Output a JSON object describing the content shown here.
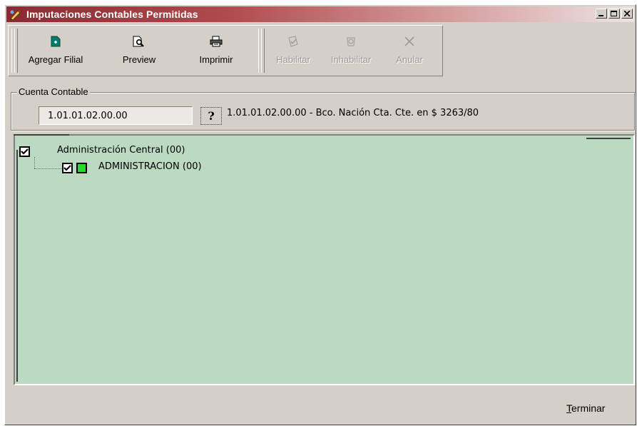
{
  "window": {
    "title": "Imputaciones Contables Permitidas",
    "controls": [
      "minimize",
      "maximize",
      "close"
    ]
  },
  "toolbar": {
    "buttons": [
      {
        "label": "Agregar Filial",
        "icon": "add-document-icon",
        "enabled": true
      },
      {
        "label": "Preview",
        "icon": "print-preview-icon",
        "enabled": true
      },
      {
        "label": "Imprimir",
        "icon": "printer-icon",
        "enabled": true
      },
      {
        "label": "Habilitar",
        "icon": "enable-check-icon",
        "enabled": false
      },
      {
        "label": "Inhabilitar",
        "icon": "disable-icon",
        "enabled": false
      },
      {
        "label": "Anular",
        "icon": "cancel-x-icon",
        "enabled": false
      }
    ]
  },
  "cuenta": {
    "legend": "Cuenta Contable",
    "value": "1.01.01.02.00.00",
    "help_glyph": "?",
    "description": "1.01.01.02.00.00  -  Bco. Nación Cta. Cte. en $ 3263/80"
  },
  "tree": {
    "root": {
      "label": "Administración Central (00)",
      "checked": true
    },
    "children": [
      {
        "label": "ADMINISTRACION (00)",
        "checked": true,
        "status_color": "#22dd22"
      }
    ]
  },
  "footer": {
    "terminar_first": "T",
    "terminar_rest": "erminar"
  },
  "colors": {
    "window_bg": "#d4d0c8",
    "tree_bg": "#bcd9c2",
    "titlebar_start": "#8a2a33"
  }
}
